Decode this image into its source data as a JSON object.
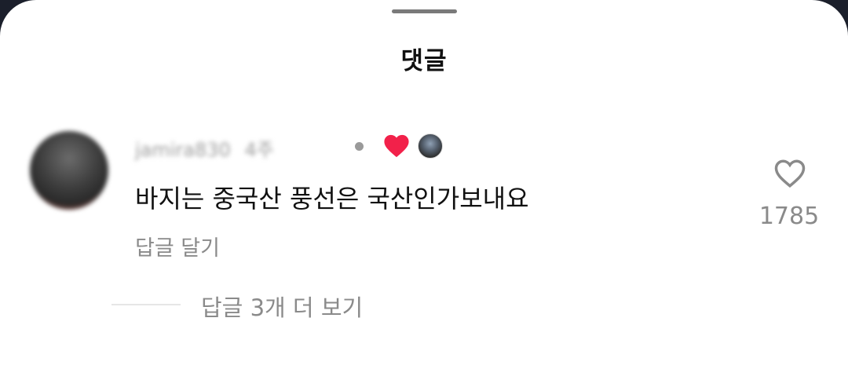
{
  "header": {
    "title": "댓글"
  },
  "comment": {
    "username": "jamira830",
    "meta": "4주",
    "text": "바지는 중국산 풍선은 국산인가보내요",
    "reply_label": "답글 달기",
    "likes": "1785",
    "view_replies": "답글 3개 더 보기"
  },
  "colors": {
    "creator_heart": "#f2214a",
    "secondary_text": "#8a8a8a",
    "overlay": "#1b1f2b"
  },
  "icons": {
    "creator_liked": "heart-filled-icon",
    "like": "heart-outline-icon"
  }
}
